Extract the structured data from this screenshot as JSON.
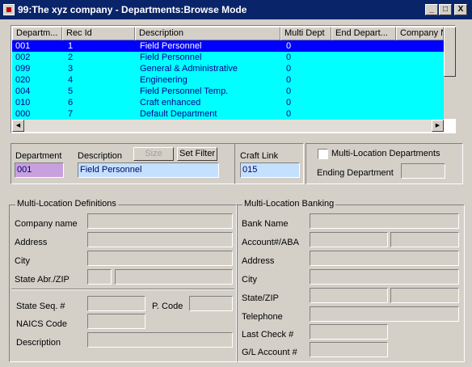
{
  "window": {
    "title": "99:The xyz company - Departments:Browse Mode",
    "min_label": "_",
    "max_label": "□",
    "close_label": "X"
  },
  "grid": {
    "columns": [
      "Departm...",
      "Rec Id",
      "Description",
      "Multi Dept",
      "End Depart...",
      "Company N"
    ],
    "rows": [
      [
        "001",
        "1",
        "Field Personnel",
        "0"
      ],
      [
        "002",
        "2",
        "Field Personnel",
        "0"
      ],
      [
        "099",
        "3",
        "General & Administrative",
        "0"
      ],
      [
        "020",
        "4",
        "Engineering",
        "0"
      ],
      [
        "004",
        "5",
        "Field Personnel Temp.",
        "0"
      ],
      [
        "010",
        "6",
        "Craft enhanced",
        "0"
      ],
      [
        "000",
        "7",
        "Default Department",
        "0"
      ]
    ],
    "selected_row": 0
  },
  "detail": {
    "department_label": "Department",
    "department_value": "001",
    "description_label": "Description",
    "description_value": "Field Personnel",
    "size_button": "Size",
    "set_filter_button": "Set Filter",
    "craft_link_label": "Craft Link",
    "craft_link_value": "015",
    "multi_location_label": "Multi-Location Departments",
    "ending_department_label": "Ending Department",
    "ending_department_value": ""
  },
  "definitions": {
    "title": "Multi-Location Definitions",
    "company_name": "Company name",
    "address": "Address",
    "city": "City",
    "state_zip": "State Abr./ZIP",
    "state_seq": "State Seq. #",
    "p_code": "P. Code",
    "naics": "NAICS Code",
    "description": "Description"
  },
  "banking": {
    "title": "Multi-Location Banking",
    "bank_name": "Bank Name",
    "account_aba": "Account#/ABA",
    "address": "Address",
    "city": "City",
    "state_zip": "State/ZIP",
    "telephone": "Telephone",
    "last_check": "Last Check #",
    "gl_account": "G/L Account #"
  },
  "colors": {
    "titlebar": "#0a246a",
    "row_bg": "#00ffff",
    "selected_row_bg": "#0000ff",
    "field_blue": "#c4e0ff",
    "field_lavender": "#c8a0e0"
  }
}
